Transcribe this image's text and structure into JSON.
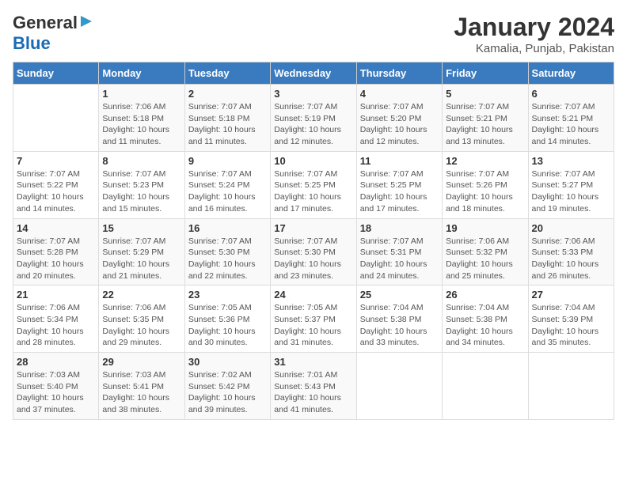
{
  "logo": {
    "general": "General",
    "blue": "Blue"
  },
  "title": "January 2024",
  "subtitle": "Kamalia, Punjab, Pakistan",
  "days_of_week": [
    "Sunday",
    "Monday",
    "Tuesday",
    "Wednesday",
    "Thursday",
    "Friday",
    "Saturday"
  ],
  "weeks": [
    [
      {
        "num": "",
        "info": ""
      },
      {
        "num": "1",
        "info": "Sunrise: 7:06 AM\nSunset: 5:18 PM\nDaylight: 10 hours\nand 11 minutes."
      },
      {
        "num": "2",
        "info": "Sunrise: 7:07 AM\nSunset: 5:18 PM\nDaylight: 10 hours\nand 11 minutes."
      },
      {
        "num": "3",
        "info": "Sunrise: 7:07 AM\nSunset: 5:19 PM\nDaylight: 10 hours\nand 12 minutes."
      },
      {
        "num": "4",
        "info": "Sunrise: 7:07 AM\nSunset: 5:20 PM\nDaylight: 10 hours\nand 12 minutes."
      },
      {
        "num": "5",
        "info": "Sunrise: 7:07 AM\nSunset: 5:21 PM\nDaylight: 10 hours\nand 13 minutes."
      },
      {
        "num": "6",
        "info": "Sunrise: 7:07 AM\nSunset: 5:21 PM\nDaylight: 10 hours\nand 14 minutes."
      }
    ],
    [
      {
        "num": "7",
        "info": "Sunrise: 7:07 AM\nSunset: 5:22 PM\nDaylight: 10 hours\nand 14 minutes."
      },
      {
        "num": "8",
        "info": "Sunrise: 7:07 AM\nSunset: 5:23 PM\nDaylight: 10 hours\nand 15 minutes."
      },
      {
        "num": "9",
        "info": "Sunrise: 7:07 AM\nSunset: 5:24 PM\nDaylight: 10 hours\nand 16 minutes."
      },
      {
        "num": "10",
        "info": "Sunrise: 7:07 AM\nSunset: 5:25 PM\nDaylight: 10 hours\nand 17 minutes."
      },
      {
        "num": "11",
        "info": "Sunrise: 7:07 AM\nSunset: 5:25 PM\nDaylight: 10 hours\nand 17 minutes."
      },
      {
        "num": "12",
        "info": "Sunrise: 7:07 AM\nSunset: 5:26 PM\nDaylight: 10 hours\nand 18 minutes."
      },
      {
        "num": "13",
        "info": "Sunrise: 7:07 AM\nSunset: 5:27 PM\nDaylight: 10 hours\nand 19 minutes."
      }
    ],
    [
      {
        "num": "14",
        "info": "Sunrise: 7:07 AM\nSunset: 5:28 PM\nDaylight: 10 hours\nand 20 minutes."
      },
      {
        "num": "15",
        "info": "Sunrise: 7:07 AM\nSunset: 5:29 PM\nDaylight: 10 hours\nand 21 minutes."
      },
      {
        "num": "16",
        "info": "Sunrise: 7:07 AM\nSunset: 5:30 PM\nDaylight: 10 hours\nand 22 minutes."
      },
      {
        "num": "17",
        "info": "Sunrise: 7:07 AM\nSunset: 5:30 PM\nDaylight: 10 hours\nand 23 minutes."
      },
      {
        "num": "18",
        "info": "Sunrise: 7:07 AM\nSunset: 5:31 PM\nDaylight: 10 hours\nand 24 minutes."
      },
      {
        "num": "19",
        "info": "Sunrise: 7:06 AM\nSunset: 5:32 PM\nDaylight: 10 hours\nand 25 minutes."
      },
      {
        "num": "20",
        "info": "Sunrise: 7:06 AM\nSunset: 5:33 PM\nDaylight: 10 hours\nand 26 minutes."
      }
    ],
    [
      {
        "num": "21",
        "info": "Sunrise: 7:06 AM\nSunset: 5:34 PM\nDaylight: 10 hours\nand 28 minutes."
      },
      {
        "num": "22",
        "info": "Sunrise: 7:06 AM\nSunset: 5:35 PM\nDaylight: 10 hours\nand 29 minutes."
      },
      {
        "num": "23",
        "info": "Sunrise: 7:05 AM\nSunset: 5:36 PM\nDaylight: 10 hours\nand 30 minutes."
      },
      {
        "num": "24",
        "info": "Sunrise: 7:05 AM\nSunset: 5:37 PM\nDaylight: 10 hours\nand 31 minutes."
      },
      {
        "num": "25",
        "info": "Sunrise: 7:04 AM\nSunset: 5:38 PM\nDaylight: 10 hours\nand 33 minutes."
      },
      {
        "num": "26",
        "info": "Sunrise: 7:04 AM\nSunset: 5:38 PM\nDaylight: 10 hours\nand 34 minutes."
      },
      {
        "num": "27",
        "info": "Sunrise: 7:04 AM\nSunset: 5:39 PM\nDaylight: 10 hours\nand 35 minutes."
      }
    ],
    [
      {
        "num": "28",
        "info": "Sunrise: 7:03 AM\nSunset: 5:40 PM\nDaylight: 10 hours\nand 37 minutes."
      },
      {
        "num": "29",
        "info": "Sunrise: 7:03 AM\nSunset: 5:41 PM\nDaylight: 10 hours\nand 38 minutes."
      },
      {
        "num": "30",
        "info": "Sunrise: 7:02 AM\nSunset: 5:42 PM\nDaylight: 10 hours\nand 39 minutes."
      },
      {
        "num": "31",
        "info": "Sunrise: 7:01 AM\nSunset: 5:43 PM\nDaylight: 10 hours\nand 41 minutes."
      },
      {
        "num": "",
        "info": ""
      },
      {
        "num": "",
        "info": ""
      },
      {
        "num": "",
        "info": ""
      }
    ]
  ]
}
